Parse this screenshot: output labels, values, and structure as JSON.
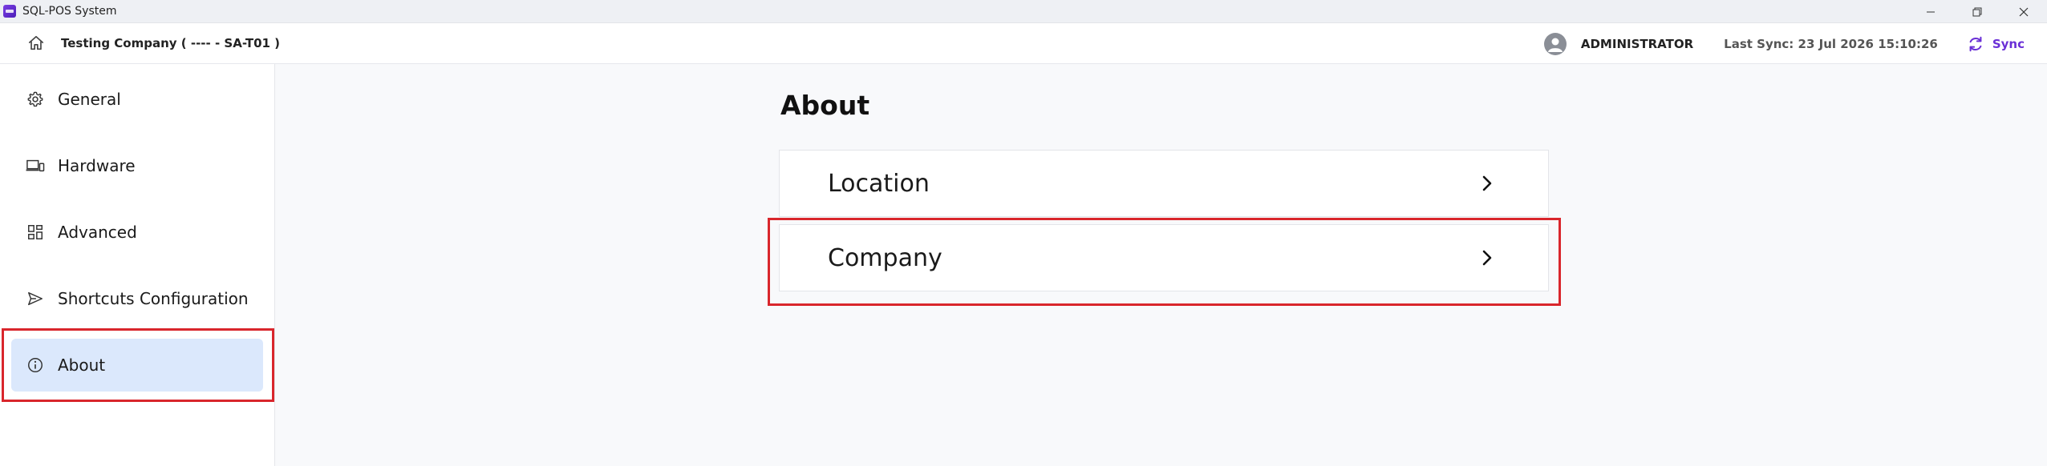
{
  "window": {
    "title": "SQL-POS System",
    "controls": {
      "minimize": "—",
      "restore": "❐",
      "close": "✕"
    }
  },
  "header": {
    "company": "Testing Company ( ---- - SA-T01 )",
    "user": "ADMINISTRATOR",
    "last_sync": "Last Sync: 23 Jul 2026 15:10:26",
    "sync_label": "Sync",
    "home_icon": "home-icon",
    "avatar_icon": "user-avatar-icon",
    "sync_icon": "refresh-icon"
  },
  "sidebar": {
    "items": [
      {
        "label": "General",
        "icon": "gear-icon",
        "active": false
      },
      {
        "label": "Hardware",
        "icon": "devices-icon",
        "active": false
      },
      {
        "label": "Advanced",
        "icon": "grid-icon",
        "active": false
      },
      {
        "label": "Shortcuts Configuration",
        "icon": "send-icon",
        "active": false
      },
      {
        "label": "About",
        "icon": "info-icon",
        "active": true
      }
    ]
  },
  "main": {
    "title": "About",
    "cards": [
      {
        "label": "Location",
        "icon": "chevron-right-icon"
      },
      {
        "label": "Company",
        "icon": "chevron-right-icon"
      }
    ]
  },
  "colors": {
    "accent": "#6a2fd6",
    "active_bg": "#dbe8fc",
    "highlight": "#d9262c",
    "page_bg": "#f8f9fb"
  }
}
